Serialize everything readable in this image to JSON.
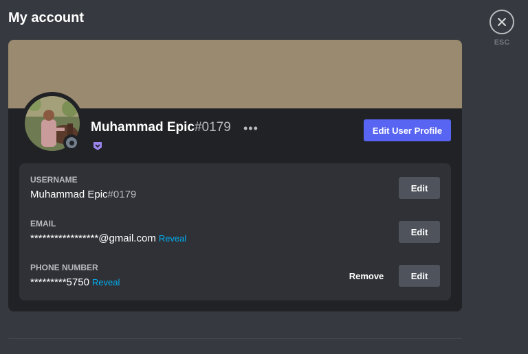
{
  "header": {
    "title": "My account",
    "close_hint": "ESC"
  },
  "profile": {
    "display_name": "Muhammad Epic",
    "discriminator": "#0179",
    "more_icon": "more-options-icon",
    "badge_icon": "hypesquad-badge-icon",
    "edit_profile_label": "Edit User Profile",
    "banner_color": "#9a8a6f",
    "accent_color": "#5865f2"
  },
  "fields": {
    "username": {
      "label": "USERNAME",
      "name": "Muhammad Epic",
      "tag": "#0179",
      "edit_label": "Edit"
    },
    "email": {
      "label": "EMAIL",
      "value": "*****************@gmail.com",
      "reveal_label": "Reveal",
      "edit_label": "Edit"
    },
    "phone": {
      "label": "PHONE NUMBER",
      "value": "*********5750",
      "reveal_label": "Reveal",
      "remove_label": "Remove",
      "edit_label": "Edit"
    }
  }
}
